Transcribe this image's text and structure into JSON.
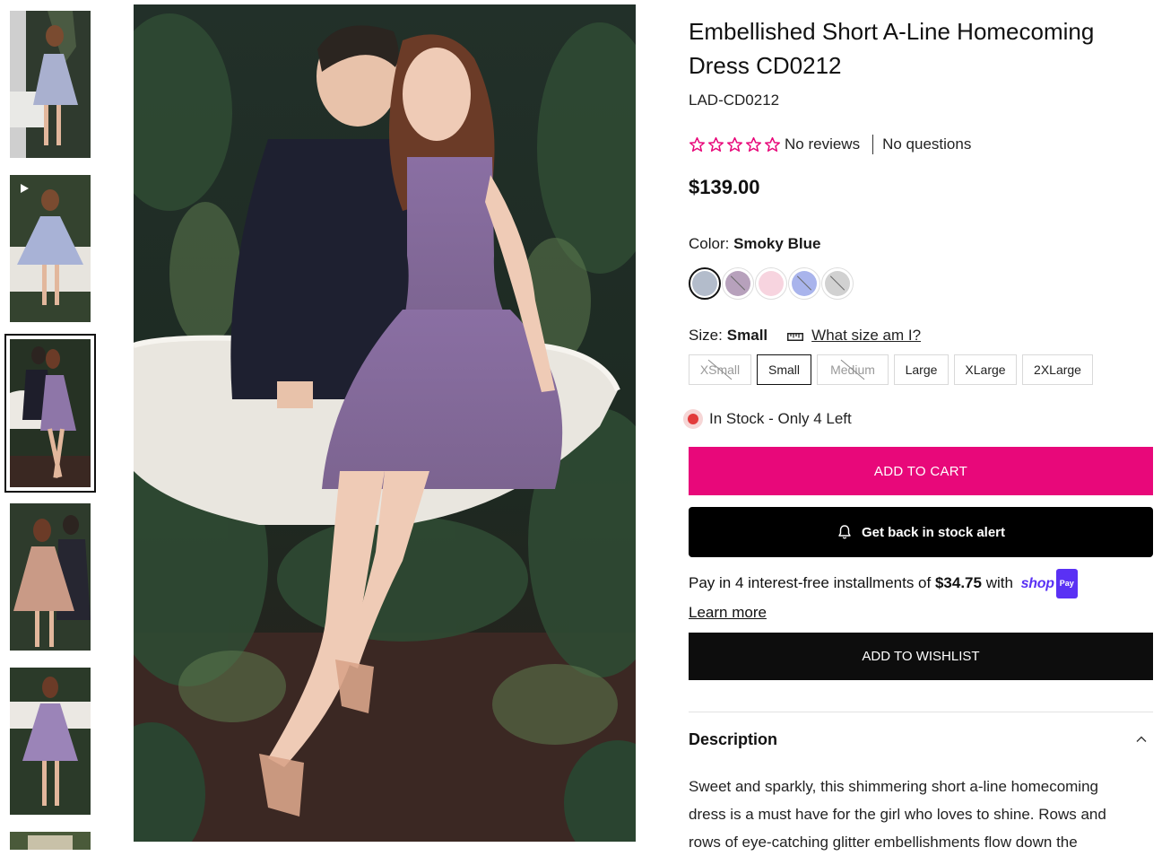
{
  "gallery": {
    "thumbnails": [
      {
        "alt": "smoky-blue-back-view",
        "color": "#a9b0cf",
        "video": false
      },
      {
        "alt": "smoky-blue-video",
        "color": "#a8b2d6",
        "video": true
      },
      {
        "alt": "lavender-couple-view",
        "color": "#8e76a8",
        "video": false,
        "active": true
      },
      {
        "alt": "rose-gold-couple-view",
        "color": "#c99a86",
        "video": false
      },
      {
        "alt": "lavender-front-view",
        "color": "#9b84b8",
        "video": false
      }
    ],
    "play_icon": "play-icon",
    "main_image_icon": "product-photo"
  },
  "product": {
    "title": "Embellished Short A-Line Homecoming Dress CD0212",
    "sku": "LAD-CD0212",
    "rating": {
      "stars": 5,
      "filled": 0,
      "reviews_text": "No reviews",
      "questions_text": "No questions",
      "star_color": "#e8087a"
    },
    "price": "$139.00",
    "color": {
      "label": "Color:",
      "selected": "Smoky Blue",
      "swatches": [
        {
          "name": "Smoky Blue",
          "hex": "#b3bccb",
          "selected": true,
          "unavailable": false
        },
        {
          "name": "Lavender",
          "hex": "#b7a1bc",
          "selected": false,
          "unavailable": true
        },
        {
          "name": "Blush",
          "hex": "#f7d4df",
          "selected": false,
          "unavailable": false
        },
        {
          "name": "Periwinkle",
          "hex": "#a9b4ec",
          "selected": false,
          "unavailable": true
        },
        {
          "name": "Silver",
          "hex": "#d1d1d1",
          "selected": false,
          "unavailable": true
        }
      ]
    },
    "size": {
      "label": "Size:",
      "selected": "Small",
      "guide_text": "What size am I?",
      "guide_icon": "ruler-icon",
      "options": [
        {
          "label": "XSmall",
          "selected": false,
          "unavailable": true
        },
        {
          "label": "Small",
          "selected": true,
          "unavailable": false
        },
        {
          "label": "Medium",
          "selected": false,
          "unavailable": true
        },
        {
          "label": "Large",
          "selected": false,
          "unavailable": false
        },
        {
          "label": "XLarge",
          "selected": false,
          "unavailable": false
        },
        {
          "label": "2XLarge",
          "selected": false,
          "unavailable": false
        }
      ]
    },
    "stock": {
      "text": "In Stock - Only 4 Left",
      "dot_color": "#e23b3b"
    },
    "add_to_cart_label": "ADD TO CART",
    "add_to_cart_color": "#e8087a",
    "stock_alert_label": "Get back in stock alert",
    "stock_alert_icon": "bell-icon",
    "installments": {
      "prefix": "Pay in 4 interest-free installments of ",
      "amount": "$34.75",
      "suffix": " with",
      "provider_word": "shop",
      "provider_badge": "Pay",
      "provider_color": "#5a31f4",
      "learn_more": "Learn more"
    },
    "wishlist_label": "ADD TO WISHLIST",
    "description": {
      "heading": "Description",
      "toggle_icon": "chevron-up-icon",
      "text": "Sweet and sparkly, this shimmering short a-line homecoming dress is a must have for the girl who loves to shine. Rows and rows of eye-catching glitter embellishments flow down the"
    }
  }
}
